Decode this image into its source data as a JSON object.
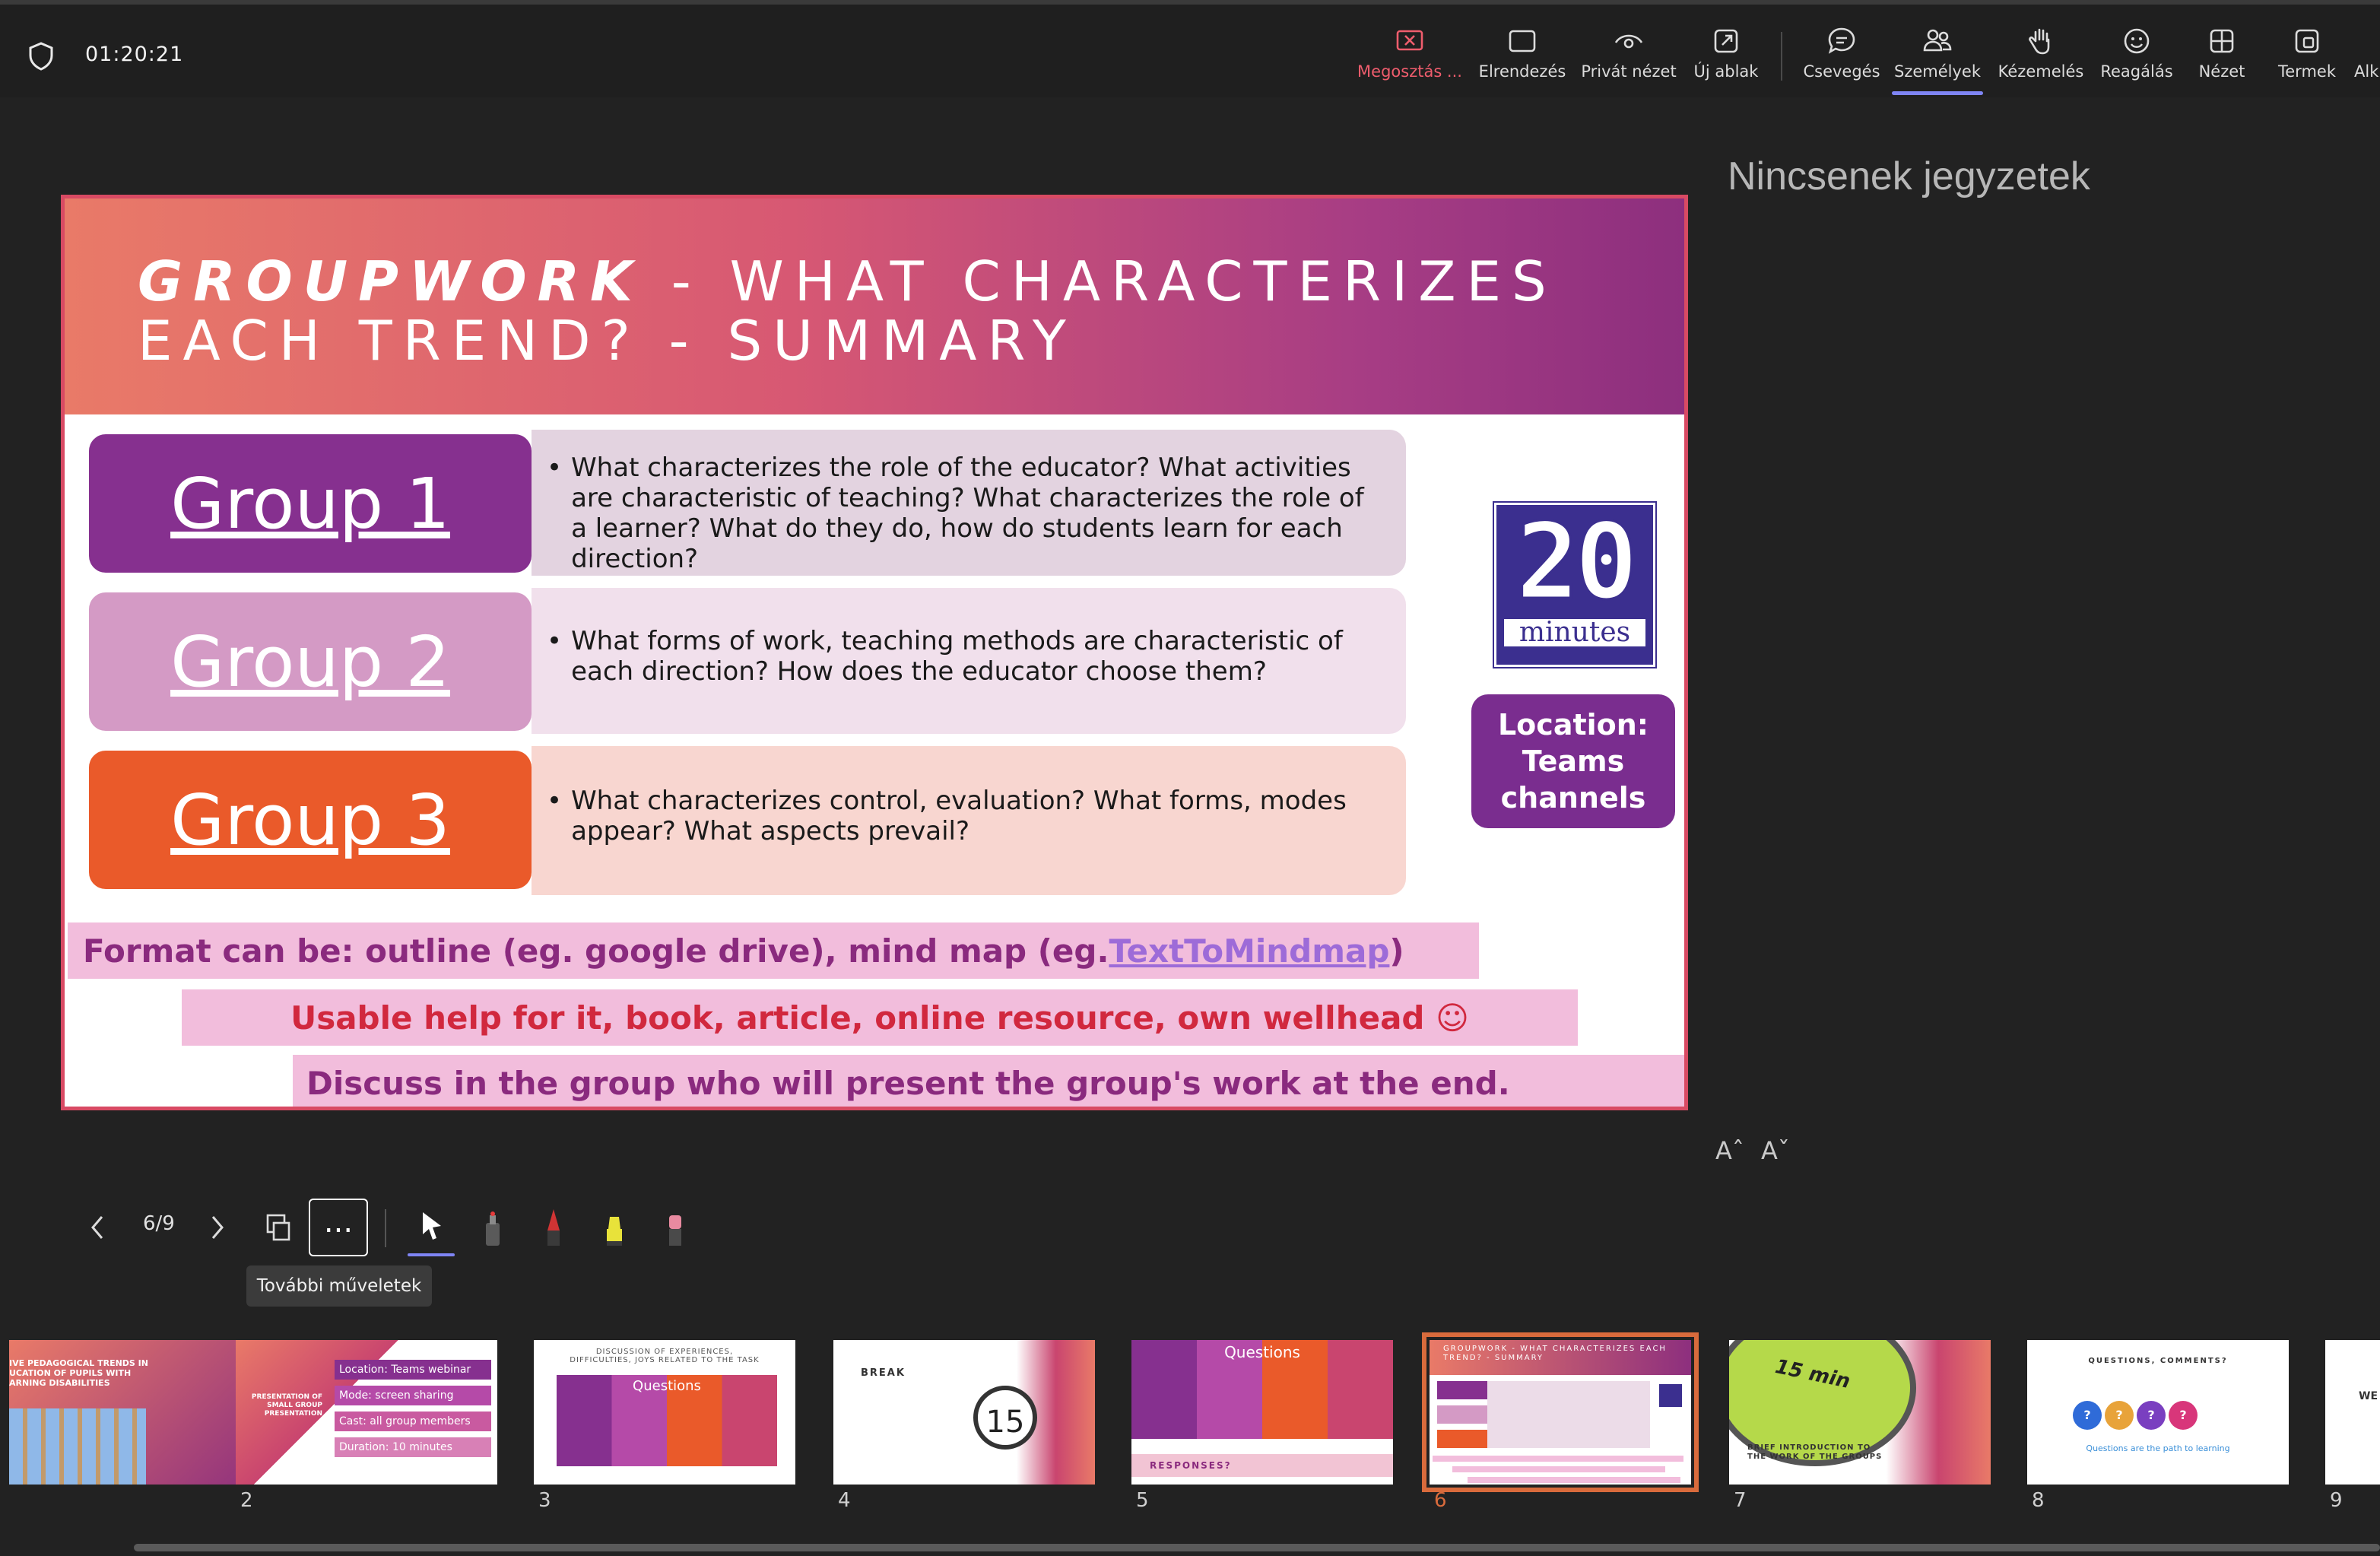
{
  "topbar": {
    "timer": "01:20:21",
    "buttons": [
      {
        "label": "Megosztás ...",
        "icon": "stop-share-icon"
      },
      {
        "label": "Elrendezés",
        "icon": "layout-icon"
      },
      {
        "label": "Privát nézet",
        "icon": "eye-icon"
      },
      {
        "label": "Új ablak",
        "icon": "new-window-icon"
      },
      {
        "label": "Csevegés",
        "icon": "chat-icon"
      },
      {
        "label": "Személyek",
        "icon": "people-icon"
      },
      {
        "label": "Kézemelés",
        "icon": "raise-hand-icon"
      },
      {
        "label": "Reagálás",
        "icon": "smiley-icon"
      },
      {
        "label": "Nézet",
        "icon": "grid-icon"
      },
      {
        "label": "Termek",
        "icon": "rooms-icon"
      },
      {
        "label": "Alk",
        "icon": "apps-icon"
      }
    ]
  },
  "notes": {
    "empty_text": "Nincsenek jegyzetek"
  },
  "font_controls": {
    "increase": "Aˆ",
    "decrease": "Aˇ"
  },
  "slide": {
    "title_bold": "GROUPWORK",
    "title_rest": " - WHAT CHARACTERIZES",
    "title_line2": "EACH TREND? - SUMMARY",
    "groups": [
      {
        "name": "Group 1",
        "color": "#86308f",
        "question_bg": "#e3d3e0",
        "question": "What characterizes the role of the educator? What activities are characteristic of teaching? What characterizes the role of a learner? What do they do, how do students learn for each direction?"
      },
      {
        "name": "Group 2",
        "color": "#d49ac5",
        "question_bg": "#f1e0ec",
        "question": "What forms of work, teaching methods are characteristic of each direction? How does the educator choose them?"
      },
      {
        "name": "Group 3",
        "color": "#ea5a2a",
        "question_bg": "#f8d6d0",
        "question": "What characterizes control, evaluation? What forms, modes appear? What aspects prevail?"
      }
    ],
    "timer_badge": {
      "number": "20",
      "unit": "minutes"
    },
    "location": "Location: Teams channels",
    "format_prefix": "Format can be: outline (eg. google drive), mind map (eg. ",
    "format_link": "TextToMindmap",
    "format_suffix": ")",
    "usable_help": "Usable help for it, book, article, online resource, own wellhead ☺",
    "discuss": "Discuss in the group who will present the group's work at the end."
  },
  "controls": {
    "page_counter": "6/9",
    "more_actions_tooltip": "További műveletek",
    "more_label": "..."
  },
  "thumbnails": [
    {
      "number": "",
      "title": "IVE PEDAGOGICAL TRENDS IN UCATION OF PUPILS WITH ARNING DISABILITIES"
    },
    {
      "number": "2",
      "title": "PRESENTATION OF SMALL GROUP PRESENTATION",
      "items": [
        "Location: Teams webinar",
        "Mode: screen sharing",
        "Cast: all group members",
        "Duration: 10 minutes"
      ]
    },
    {
      "number": "3",
      "title": "DISCUSSION OF EXPERIENCES, DIFFICULTIES, JOYS RELATED TO THE TASK",
      "subtitle": "Questions"
    },
    {
      "number": "4",
      "title": "BREAK",
      "badge": "15"
    },
    {
      "number": "5",
      "title": "Questions",
      "footer": "RESPONSES?"
    },
    {
      "number": "6",
      "title": "GROUPWORK - WHAT CHARACTERIZES EACH TREND? - SUMMARY"
    },
    {
      "number": "7",
      "title": "BRIEF INTRODUCTION TO THE WORK OF THE GROUPS",
      "badge": "15 min"
    },
    {
      "number": "8",
      "title": "QUESTIONS, COMMENTS?",
      "caption": "Questions are the path to learning"
    },
    {
      "number": "9",
      "title": "WE"
    }
  ]
}
